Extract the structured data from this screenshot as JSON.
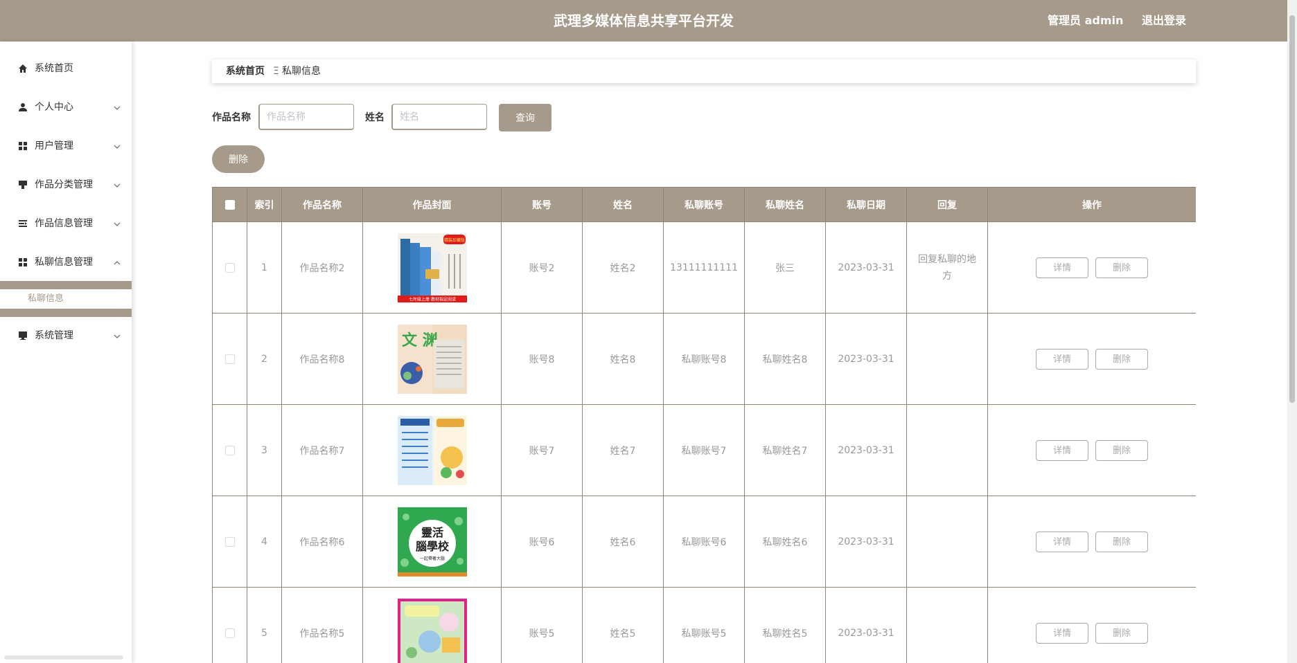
{
  "header": {
    "title": "武理多媒体信息共享平台开发",
    "user_label": "管理员 admin",
    "logout_label": "退出登录"
  },
  "sidebar": {
    "items": [
      {
        "label": "系统首页",
        "icon": "home-icon"
      },
      {
        "label": "个人中心",
        "icon": "user-icon"
      },
      {
        "label": "用户管理",
        "icon": "grid-icon"
      },
      {
        "label": "作品分类管理",
        "icon": "brush-icon"
      },
      {
        "label": "作品信息管理",
        "icon": "list-icon"
      },
      {
        "label": "私聊信息管理",
        "icon": "grid-icon"
      },
      {
        "label": "系统管理",
        "icon": "monitor-icon"
      }
    ],
    "sub_item": "私聊信息"
  },
  "breadcrumb": {
    "home": "系统首页",
    "separator": "Ξ",
    "current": "私聊信息"
  },
  "search": {
    "work_name_label": "作品名称",
    "work_name_placeholder": "作品名称",
    "name_label": "姓名",
    "name_placeholder": "姓名",
    "query_button": "查询",
    "delete_button": "删除"
  },
  "table": {
    "headers": [
      "索引",
      "作品名称",
      "作品封面",
      "账号",
      "姓名",
      "私聊账号",
      "私聊姓名",
      "私聊日期",
      "回复",
      "操作"
    ],
    "detail_label": "详情",
    "delete_label": "删除",
    "rows": [
      {
        "index": "1",
        "work_name": "作品名称2",
        "account": "账号2",
        "name": "姓名2",
        "chat_account": "13111111111",
        "chat_name": "张三",
        "date": "2023-03-31",
        "reply": "回复私聊的地方"
      },
      {
        "index": "2",
        "work_name": "作品名称8",
        "account": "账号8",
        "name": "姓名8",
        "chat_account": "私聊账号8",
        "chat_name": "私聊姓名8",
        "date": "2023-03-31",
        "reply": ""
      },
      {
        "index": "3",
        "work_name": "作品名称7",
        "account": "账号7",
        "name": "姓名7",
        "chat_account": "私聊账号7",
        "chat_name": "私聊姓名7",
        "date": "2023-03-31",
        "reply": ""
      },
      {
        "index": "4",
        "work_name": "作品名称6",
        "account": "账号6",
        "name": "姓名6",
        "chat_account": "私聊账号6",
        "chat_name": "私聊姓名6",
        "date": "2023-03-31",
        "reply": ""
      },
      {
        "index": "5",
        "work_name": "作品名称5",
        "account": "账号5",
        "name": "姓名5",
        "chat_account": "私聊账号5",
        "chat_name": "私聊姓名5",
        "date": "2023-03-31",
        "reply": ""
      }
    ]
  },
  "cover_text": {
    "row1_badge": "精装珍藏版",
    "row1_strip": "七年级上册 教材指定阅读",
    "row2_big": "文 渊",
    "row4_title_1": "靈活",
    "row4_title_2": "腦學校",
    "row4_sub": "一起帶著大腦"
  },
  "colors": {
    "primary": "#a69a8b",
    "border": "#8e8374"
  }
}
